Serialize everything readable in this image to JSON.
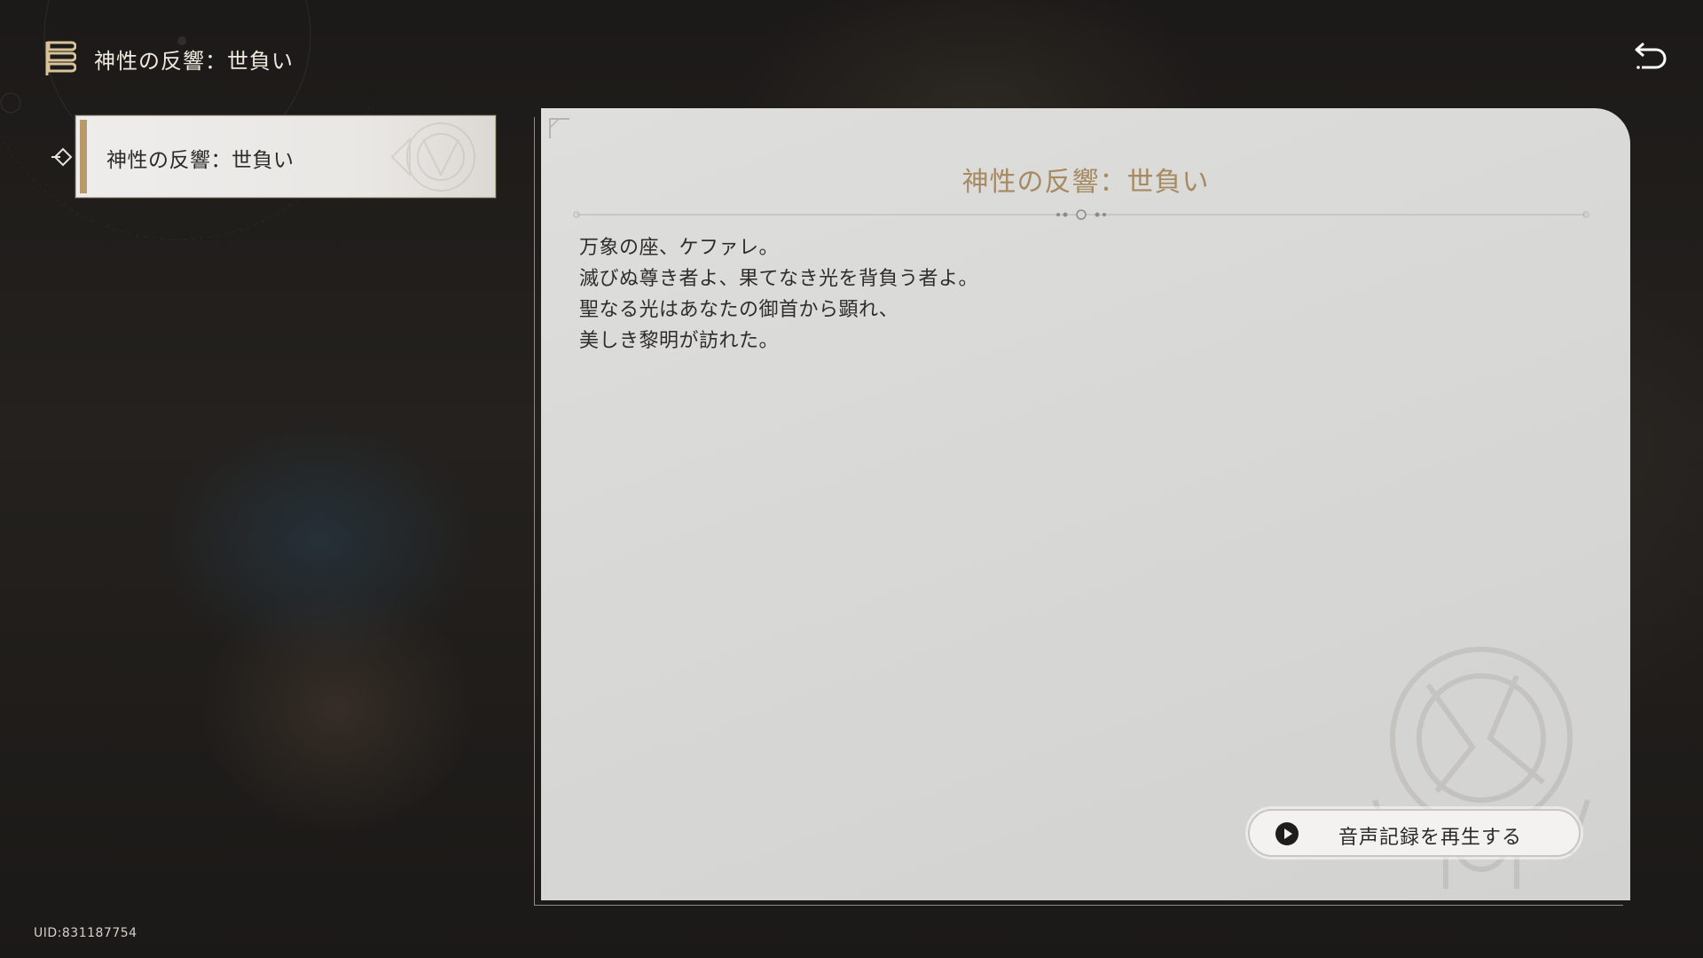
{
  "header": {
    "title": "神性の反響：世負い",
    "icon": "book-stack-icon"
  },
  "back_icon": "back-arrow-icon",
  "list": {
    "items": [
      {
        "label": "神性の反響：世負い",
        "selected": true
      }
    ]
  },
  "panel": {
    "title": "神性の反響：世負い",
    "lines": [
      "万象の座、ケファレ。",
      "滅びぬ尊き者よ、果てなき光を背負う者よ。",
      "聖なる光はあなたの御首から顕れ、",
      "美しき黎明が訪れた。"
    ],
    "play_button_label": "音声記録を再生する"
  },
  "uid": "UID:831187754",
  "colors": {
    "accent_gold": "#b89a6a",
    "title_gold": "#a68a62",
    "panel_bg": "#d8d8d6",
    "background": "#1f1d1b"
  }
}
